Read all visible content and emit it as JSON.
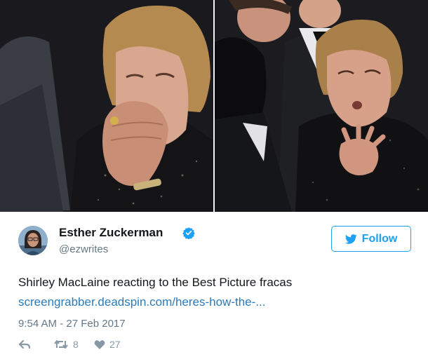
{
  "photos": {
    "left": {
      "icon": "photo-reaction-hand-over-mouth"
    },
    "right": {
      "icon": "photo-reaction-hand-on-chest"
    }
  },
  "tweet": {
    "author": {
      "display_name": "Esther Zuckerman",
      "handle": "@ezwrites",
      "verified": true,
      "avatar_icon": "avatar-icon"
    },
    "follow_label": "Follow",
    "text": "Shirley MacLaine reacting to the Best Picture fracas",
    "link": "screengrabber.deadspin.com/heres-how-the-...",
    "timestamp": "9:54 AM - 27 Feb 2017",
    "retweet_count": "8",
    "like_count": "27"
  },
  "colors": {
    "twitter_blue": "#1da1f2",
    "link_blue": "#2b7bb9",
    "secondary_text": "#657786",
    "action_gray": "#8899a6"
  }
}
